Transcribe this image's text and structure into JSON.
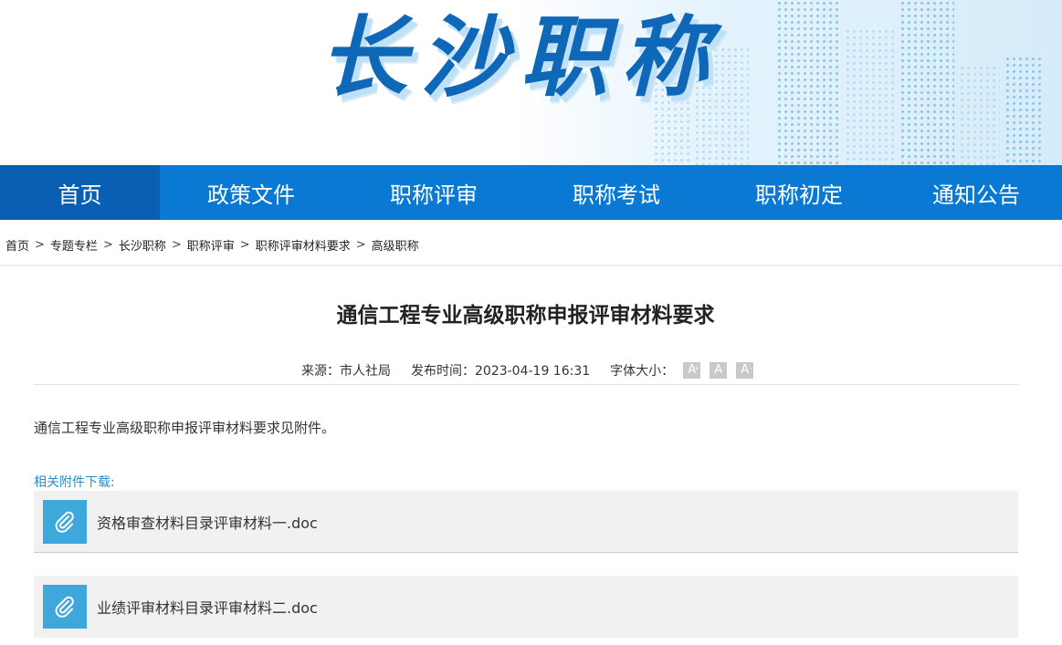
{
  "banner": {
    "title": "长沙职称"
  },
  "nav": {
    "items": [
      {
        "label": "首页"
      },
      {
        "label": "政策文件"
      },
      {
        "label": "职称评审"
      },
      {
        "label": "职称考试"
      },
      {
        "label": "职称初定"
      },
      {
        "label": "通知公告"
      }
    ]
  },
  "breadcrumb": {
    "items": [
      "首页",
      "专题专栏",
      "长沙职称",
      "职称评审",
      "职称评审材料要求",
      "高级职称"
    ],
    "separator": ">"
  },
  "article": {
    "title": "通信工程专业高级职称申报评审材料要求",
    "source_label": "来源：市人社局",
    "publish_label": "发布时间：2023-04-19 16:31",
    "font_size_label": "字体大小：",
    "font_buttons": {
      "increase": "A",
      "normal": "A",
      "decrease": "A",
      "increase_mark": "+",
      "decrease_mark": "-"
    },
    "body": "通信工程专业高级职称申报评审材料要求见附件。",
    "attachments_heading": "相关附件下载:",
    "attachments": [
      {
        "name": "资格审查材料目录评审材料一.doc",
        "icon": "paperclip-icon"
      },
      {
        "name": "业绩评审材料目录评审材料二.doc",
        "icon": "paperclip-icon"
      }
    ]
  },
  "colors": {
    "nav": "#0a79d4",
    "nav_active": "#0a5fb3",
    "accent": "#2a8ec7",
    "attach_icon": "#3ea7dc"
  }
}
